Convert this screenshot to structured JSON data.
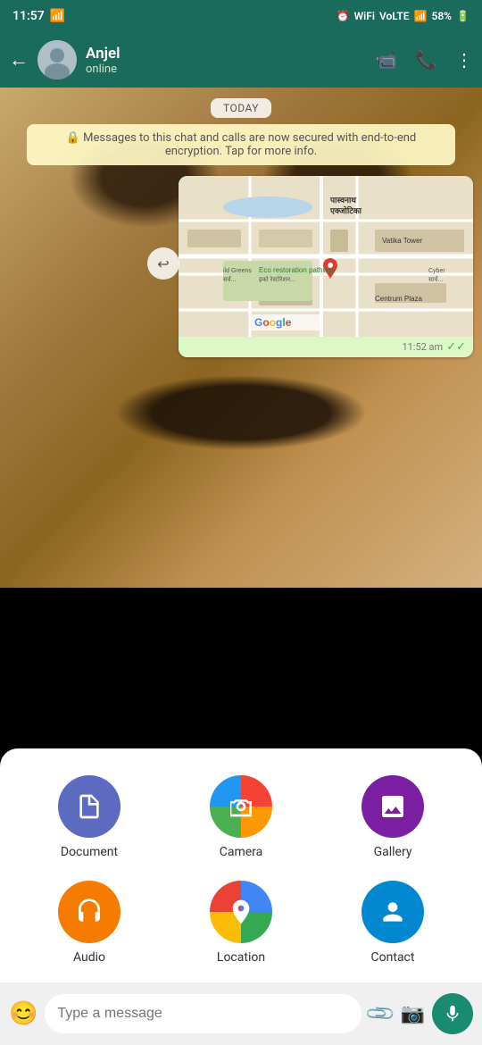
{
  "statusBar": {
    "time": "11:57",
    "battery": "58%",
    "signal": "VoLTE"
  },
  "header": {
    "contactName": "Anjel",
    "status": "online",
    "backLabel": "←",
    "videoIcon": "📹",
    "callIcon": "📞",
    "menuIcon": "⋮"
  },
  "chat": {
    "todayLabel": "TODAY",
    "encryptionMessage": "🔒 Messages to this chat and calls are now secured with end-to-end encryption. Tap for more info.",
    "mapTime": "11:52 am",
    "mapTick": "✓✓",
    "forwardIcon": "↩"
  },
  "attachPanel": {
    "items": [
      {
        "id": "document",
        "label": "Document",
        "icon": "📄",
        "color": "#5c6bc0"
      },
      {
        "id": "camera",
        "label": "Camera",
        "icon": "📷",
        "color": "multi"
      },
      {
        "id": "gallery",
        "label": "Gallery",
        "icon": "🖼",
        "color": "#7b1fa2"
      },
      {
        "id": "audio",
        "label": "Audio",
        "icon": "🎧",
        "color": "#f57c00"
      },
      {
        "id": "location",
        "label": "Location",
        "icon": "📍",
        "color": "#388e3c"
      },
      {
        "id": "contact",
        "label": "Contact",
        "icon": "👤",
        "color": "#0288d1"
      }
    ]
  },
  "inputBar": {
    "placeholder": "Type a message",
    "emojiIcon": "😊",
    "attachIcon": "📎",
    "cameraIcon": "📷",
    "micIcon": "🎤"
  },
  "mapLabels": {
    "ecoPath": "Eco restoration pathway",
    "google": "Google",
    "vatikaTower": "Vatika Tower",
    "centrumPlaza": "Centrum Plaza",
    "paasvnath": "पास्वनाथ एक्जोटिका",
    "ecoHindi": "इको रेस्टोरेशन..."
  }
}
